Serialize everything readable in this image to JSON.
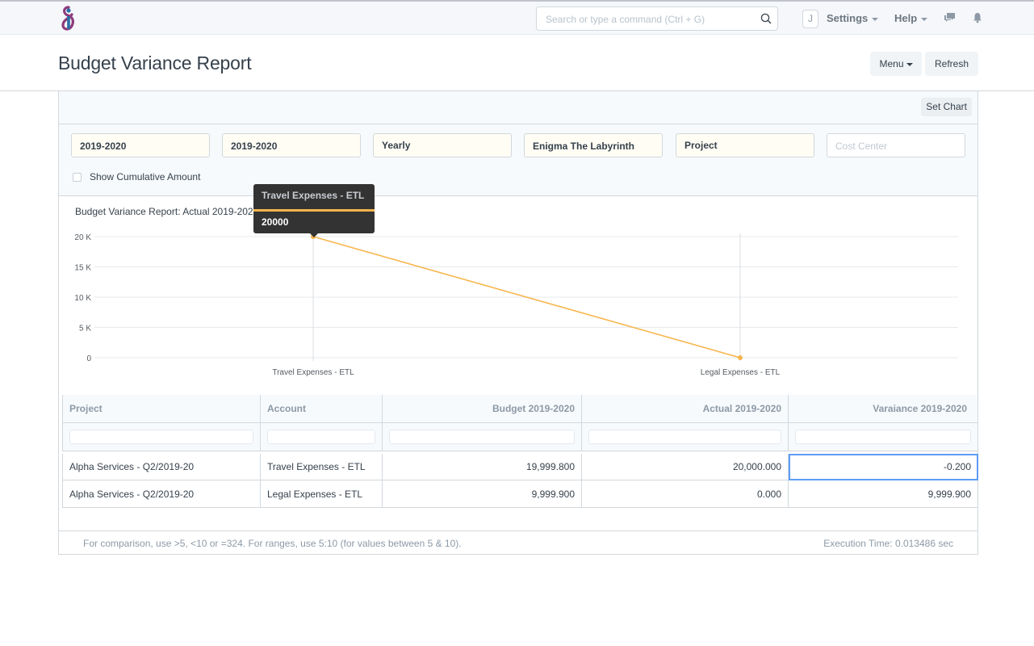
{
  "navbar": {
    "logo": "app-logo",
    "search_placeholder": "Search or type a command (Ctrl + G)",
    "avatar_initial": "J",
    "settings_label": "Settings",
    "help_label": "Help",
    "icons": [
      "search-icon",
      "chat-icon",
      "bell-icon"
    ]
  },
  "page": {
    "title": "Budget Variance Report",
    "menu_label": "Menu",
    "refresh_label": "Refresh"
  },
  "toolbar": {
    "set_chart_label": "Set Chart"
  },
  "filters": [
    {
      "name": "from-fiscal-year",
      "value": "2019-2020"
    },
    {
      "name": "to-fiscal-year",
      "value": "2019-2020"
    },
    {
      "name": "period",
      "value": "Yearly"
    },
    {
      "name": "company",
      "value": "Enigma The Labyrinth"
    },
    {
      "name": "budget-against",
      "value": "Project"
    },
    {
      "name": "cost-center",
      "value": "",
      "placeholder": "Cost Center"
    }
  ],
  "show_cumulative": {
    "label": "Show Cumulative Amount",
    "checked": false
  },
  "chart_data": {
    "type": "line",
    "title": "Budget Variance Report: Actual 2019-2020 vs Account",
    "categories": [
      "Travel Expenses - ETL",
      "Legal Expenses - ETL"
    ],
    "series": [
      {
        "name": "Actual 2019-2020",
        "values": [
          20000,
          0
        ],
        "color": "#f8b54c"
      }
    ],
    "yticks": [
      "0",
      "5 K",
      "10 K",
      "15 K",
      "20 K"
    ],
    "ytick_values": [
      0,
      5000,
      10000,
      15000,
      20000
    ],
    "ylim": [
      0,
      20000
    ],
    "grid": true,
    "tooltip": {
      "title": "Travel Expenses - ETL",
      "value": "20000"
    }
  },
  "table": {
    "columns": [
      "Project",
      "Account",
      "Budget 2019-2020",
      "Actual 2019-2020",
      "Varaiance 2019-2020"
    ],
    "rows": [
      [
        "Alpha Services - Q2/2019-20",
        "Travel Expenses - ETL",
        "19,999.800",
        "20,000.000",
        "-0.200"
      ],
      [
        "Alpha Services - Q2/2019-20",
        "Legal Expenses - ETL",
        "9,999.900",
        "0.000",
        "9,999.900"
      ]
    ]
  },
  "footer": {
    "hint": "For comparison, use >5, <10 or =324. For ranges, use 5:10 (for values between 5 & 10).",
    "execution_time": "Execution Time: 0.013486 sec"
  }
}
